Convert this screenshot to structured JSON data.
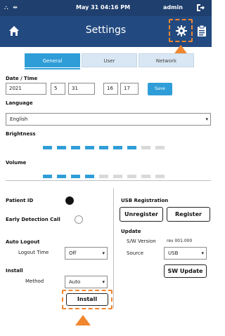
{
  "status_bar": {
    "icons": "⛬ ⇹",
    "date_time": "May 31   04:16 PM",
    "user": "admin"
  },
  "nav": {
    "title": "Settings"
  },
  "tabs": [
    {
      "label": "General",
      "active": true
    },
    {
      "label": "User",
      "active": false
    },
    {
      "label": "Network",
      "active": false
    }
  ],
  "date_time": {
    "label": "Date / Time",
    "year": "2021",
    "month": "5",
    "day": "31",
    "hour": "16",
    "minute": "17",
    "save_label": "Save"
  },
  "language": {
    "label": "Language",
    "value": "English"
  },
  "brightness": {
    "label": "Brightness",
    "level": 7,
    "max": 9
  },
  "volume": {
    "label": "Volume",
    "level": 4,
    "max": 9
  },
  "patient_id": {
    "label": "Patient ID",
    "enabled": true
  },
  "early_detection": {
    "label": "Early Detection Call",
    "enabled": false
  },
  "auto_logout": {
    "label": "Auto Logout",
    "time_label": "Logout Time",
    "value": "Off"
  },
  "install": {
    "label": "Install",
    "method_label": "Method",
    "method_value": "Auto",
    "button_label": "Install"
  },
  "usb_registration": {
    "label": "USB Registration",
    "unregister_label": "Unregister",
    "register_label": "Register"
  },
  "update": {
    "label": "Update",
    "sw_version_label": "S/W Version",
    "sw_version_value": "rev 001.000",
    "source_label": "Source",
    "source_value": "USB",
    "button_label": "SW Update"
  },
  "colors": {
    "statusbar": "#1f3f6e",
    "navbar": "#234a80",
    "accent": "#2f9ed8",
    "highlight": "#f0862e",
    "bar_on": "#2f9ed8",
    "bar_off": "#d9d9d9"
  }
}
